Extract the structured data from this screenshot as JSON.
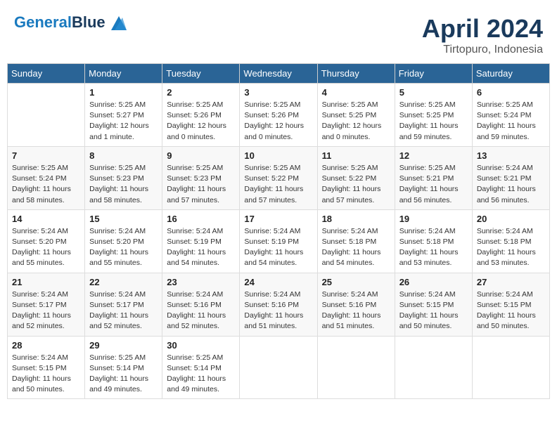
{
  "header": {
    "logo_line1": "General",
    "logo_line2": "Blue",
    "month": "April 2024",
    "location": "Tirtopuro, Indonesia"
  },
  "weekdays": [
    "Sunday",
    "Monday",
    "Tuesday",
    "Wednesday",
    "Thursday",
    "Friday",
    "Saturday"
  ],
  "weeks": [
    [
      {
        "day": "",
        "info": ""
      },
      {
        "day": "1",
        "info": "Sunrise: 5:25 AM\nSunset: 5:27 PM\nDaylight: 12 hours\nand 1 minute."
      },
      {
        "day": "2",
        "info": "Sunrise: 5:25 AM\nSunset: 5:26 PM\nDaylight: 12 hours\nand 0 minutes."
      },
      {
        "day": "3",
        "info": "Sunrise: 5:25 AM\nSunset: 5:26 PM\nDaylight: 12 hours\nand 0 minutes."
      },
      {
        "day": "4",
        "info": "Sunrise: 5:25 AM\nSunset: 5:25 PM\nDaylight: 12 hours\nand 0 minutes."
      },
      {
        "day": "5",
        "info": "Sunrise: 5:25 AM\nSunset: 5:25 PM\nDaylight: 11 hours\nand 59 minutes."
      },
      {
        "day": "6",
        "info": "Sunrise: 5:25 AM\nSunset: 5:24 PM\nDaylight: 11 hours\nand 59 minutes."
      }
    ],
    [
      {
        "day": "7",
        "info": "Sunrise: 5:25 AM\nSunset: 5:24 PM\nDaylight: 11 hours\nand 58 minutes."
      },
      {
        "day": "8",
        "info": "Sunrise: 5:25 AM\nSunset: 5:23 PM\nDaylight: 11 hours\nand 58 minutes."
      },
      {
        "day": "9",
        "info": "Sunrise: 5:25 AM\nSunset: 5:23 PM\nDaylight: 11 hours\nand 57 minutes."
      },
      {
        "day": "10",
        "info": "Sunrise: 5:25 AM\nSunset: 5:22 PM\nDaylight: 11 hours\nand 57 minutes."
      },
      {
        "day": "11",
        "info": "Sunrise: 5:25 AM\nSunset: 5:22 PM\nDaylight: 11 hours\nand 57 minutes."
      },
      {
        "day": "12",
        "info": "Sunrise: 5:25 AM\nSunset: 5:21 PM\nDaylight: 11 hours\nand 56 minutes."
      },
      {
        "day": "13",
        "info": "Sunrise: 5:24 AM\nSunset: 5:21 PM\nDaylight: 11 hours\nand 56 minutes."
      }
    ],
    [
      {
        "day": "14",
        "info": "Sunrise: 5:24 AM\nSunset: 5:20 PM\nDaylight: 11 hours\nand 55 minutes."
      },
      {
        "day": "15",
        "info": "Sunrise: 5:24 AM\nSunset: 5:20 PM\nDaylight: 11 hours\nand 55 minutes."
      },
      {
        "day": "16",
        "info": "Sunrise: 5:24 AM\nSunset: 5:19 PM\nDaylight: 11 hours\nand 54 minutes."
      },
      {
        "day": "17",
        "info": "Sunrise: 5:24 AM\nSunset: 5:19 PM\nDaylight: 11 hours\nand 54 minutes."
      },
      {
        "day": "18",
        "info": "Sunrise: 5:24 AM\nSunset: 5:18 PM\nDaylight: 11 hours\nand 54 minutes."
      },
      {
        "day": "19",
        "info": "Sunrise: 5:24 AM\nSunset: 5:18 PM\nDaylight: 11 hours\nand 53 minutes."
      },
      {
        "day": "20",
        "info": "Sunrise: 5:24 AM\nSunset: 5:18 PM\nDaylight: 11 hours\nand 53 minutes."
      }
    ],
    [
      {
        "day": "21",
        "info": "Sunrise: 5:24 AM\nSunset: 5:17 PM\nDaylight: 11 hours\nand 52 minutes."
      },
      {
        "day": "22",
        "info": "Sunrise: 5:24 AM\nSunset: 5:17 PM\nDaylight: 11 hours\nand 52 minutes."
      },
      {
        "day": "23",
        "info": "Sunrise: 5:24 AM\nSunset: 5:16 PM\nDaylight: 11 hours\nand 52 minutes."
      },
      {
        "day": "24",
        "info": "Sunrise: 5:24 AM\nSunset: 5:16 PM\nDaylight: 11 hours\nand 51 minutes."
      },
      {
        "day": "25",
        "info": "Sunrise: 5:24 AM\nSunset: 5:16 PM\nDaylight: 11 hours\nand 51 minutes."
      },
      {
        "day": "26",
        "info": "Sunrise: 5:24 AM\nSunset: 5:15 PM\nDaylight: 11 hours\nand 50 minutes."
      },
      {
        "day": "27",
        "info": "Sunrise: 5:24 AM\nSunset: 5:15 PM\nDaylight: 11 hours\nand 50 minutes."
      }
    ],
    [
      {
        "day": "28",
        "info": "Sunrise: 5:24 AM\nSunset: 5:15 PM\nDaylight: 11 hours\nand 50 minutes."
      },
      {
        "day": "29",
        "info": "Sunrise: 5:25 AM\nSunset: 5:14 PM\nDaylight: 11 hours\nand 49 minutes."
      },
      {
        "day": "30",
        "info": "Sunrise: 5:25 AM\nSunset: 5:14 PM\nDaylight: 11 hours\nand 49 minutes."
      },
      {
        "day": "",
        "info": ""
      },
      {
        "day": "",
        "info": ""
      },
      {
        "day": "",
        "info": ""
      },
      {
        "day": "",
        "info": ""
      }
    ]
  ]
}
